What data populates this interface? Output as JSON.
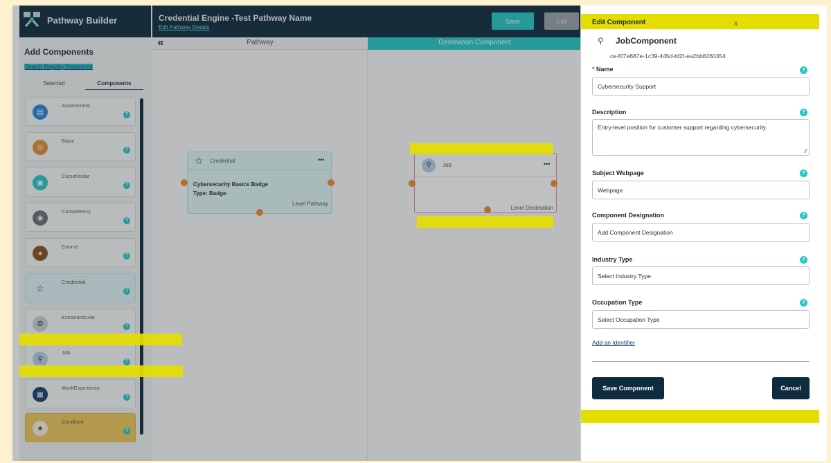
{
  "brand": {
    "title": "Pathway Builder"
  },
  "sidebar": {
    "title": "Add Components",
    "search_link": "Search Registry Resources",
    "tabs": [
      "Selected",
      "Components"
    ],
    "items": [
      {
        "label": "Assessment",
        "icon": "assessment-icon",
        "color": "#2a86d6"
      },
      {
        "label": "Basic",
        "icon": "basic-icon",
        "color": "#e58a3a"
      },
      {
        "label": "Cocurricular",
        "icon": "cocurricular-icon",
        "color": "#26c7c7"
      },
      {
        "label": "Competency",
        "icon": "competency-icon",
        "color": "#6b7278"
      },
      {
        "label": "Course",
        "icon": "course-icon",
        "color": "#8a4f1f"
      },
      {
        "label": "Credential",
        "icon": "credential-icon",
        "color": "#0f2b3f"
      },
      {
        "label": "Extracurricular",
        "icon": "extracurricular-icon",
        "color": "#9aa3a8"
      },
      {
        "label": "Job",
        "icon": "job-icon",
        "color": "#9fb7d6"
      },
      {
        "label": "WorkExperience",
        "icon": "workexperience-icon",
        "color": "#1a3f6b"
      },
      {
        "label": "Condition",
        "icon": "condition-icon",
        "color": "#e9b53a"
      }
    ],
    "help": "?"
  },
  "header": {
    "title": "Credential Engine -Test Pathway Name",
    "edit_link": "Edit Pathway Details",
    "save": "Save",
    "exit": "Exit"
  },
  "canvas": {
    "collapse": "«",
    "pathway_col": "Pathway",
    "dest_col": "Destination Component",
    "credential_node": {
      "type": "Credential",
      "menu": "•••",
      "name": "Cybersecurity Basics Badge",
      "type_line": "Type: Badge",
      "level": "Level Pathway"
    },
    "job_node": {
      "type": "Job",
      "menu": "•••",
      "level": "Level Destination"
    }
  },
  "panel": {
    "heading": "Edit Component",
    "close": "x",
    "component_name": "JobComponent",
    "component_id": "ce-f07e687e-1c39-445d-bf2f-ea2bb8260354",
    "required_mark": "*",
    "name_label": "Name",
    "name_value": "Cybersecurity Support",
    "description_label": "Description",
    "description_value": "Entry-level position for customer support  regarding cybersecurity.",
    "subject_label": "Subject Webpage",
    "subject_value": "Webpage",
    "designation_label": "Component Designation",
    "designation_value": "Add Component Designation",
    "industry_label": "Industry Type",
    "industry_value": "Select Industry Type",
    "occupation_label": "Occupation Type",
    "occupation_value": "Select Occupation Type",
    "identifier_link": "Add an Identifier",
    "save_button": "Save Component",
    "cancel_button": "Cancel",
    "help": "?"
  }
}
